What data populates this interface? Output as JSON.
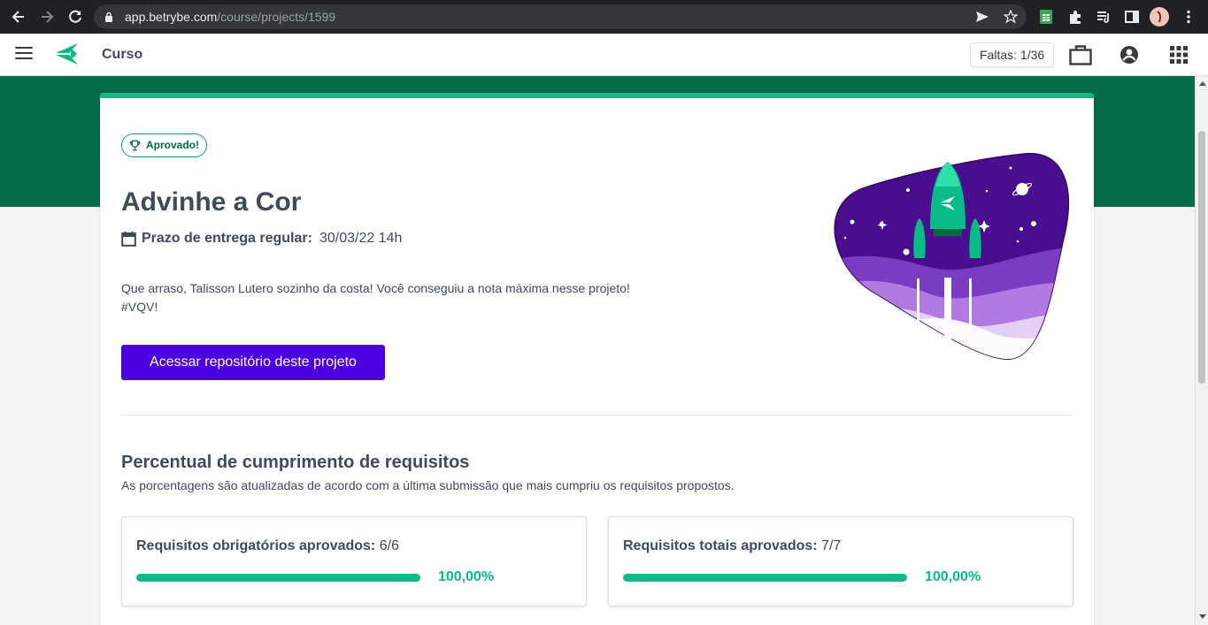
{
  "browser": {
    "url_host": "app.betrybe.com",
    "url_path": "/course/projects/1599"
  },
  "header": {
    "section_title": "Curso",
    "faltas": "Faltas: 1/36"
  },
  "project": {
    "status_badge": "Aprovado!",
    "title": "Advinhe a Cor",
    "deadline_label": "Prazo de entrega regular:",
    "deadline_value": "30/03/22 14h",
    "message_line1": "Que arraso, Talisson Lutero sozinho da costa! Você conseguiu a nota máxima nesse projeto!",
    "message_line2": "#VQV!",
    "repo_button": "Acessar repositório deste projeto"
  },
  "requirements": {
    "title": "Percentual de cumprimento de requisitos",
    "subtitle": "As porcentagens são atualizadas de acordo com a última submissão que mais cumpriu os requisitos propostos.",
    "cards": [
      {
        "label": "Requisitos obrigatórios aprovados:",
        "value": "6/6",
        "progress": 1.0,
        "percent": "100,00%"
      },
      {
        "label": "Requisitos totais aprovados:",
        "value": "7/7",
        "progress": 1.0,
        "percent": "100,00%"
      }
    ]
  },
  "colors": {
    "brand_green": "#036b45",
    "accent_green": "#0abb87",
    "button_purple": "#4c00e1",
    "illustration_purple": "#4a0d8f"
  }
}
